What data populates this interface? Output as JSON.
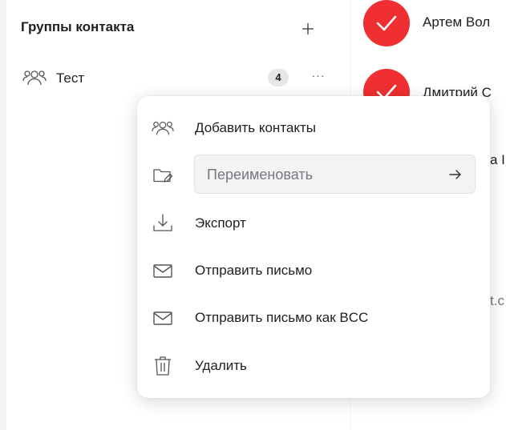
{
  "sidebar": {
    "title": "Группы контакта",
    "groups": [
      {
        "name": "Тест",
        "count": "4",
        "more": "···"
      }
    ]
  },
  "contacts": {
    "items": [
      {
        "name": "Артем Вол"
      },
      {
        "name": "Дмитрий С"
      }
    ],
    "partial_texts": [
      "а I",
      "t.c"
    ]
  },
  "menu": {
    "items": [
      {
        "label": "Добавить контакты",
        "icon": "users-icon"
      },
      {
        "label": "Переименовать",
        "icon": "folder-edit-icon",
        "input": true
      },
      {
        "label": "Экспорт",
        "icon": "download-icon"
      },
      {
        "label": "Отправить письмо",
        "icon": "mail-icon"
      },
      {
        "label": "Отправить письмо как BCC",
        "icon": "mail-icon"
      },
      {
        "label": "Удалить",
        "icon": "trash-icon"
      }
    ]
  },
  "colors": {
    "accent": "#ef2f32",
    "background": "#f3f3f4",
    "badge": "#e7e7ea"
  }
}
